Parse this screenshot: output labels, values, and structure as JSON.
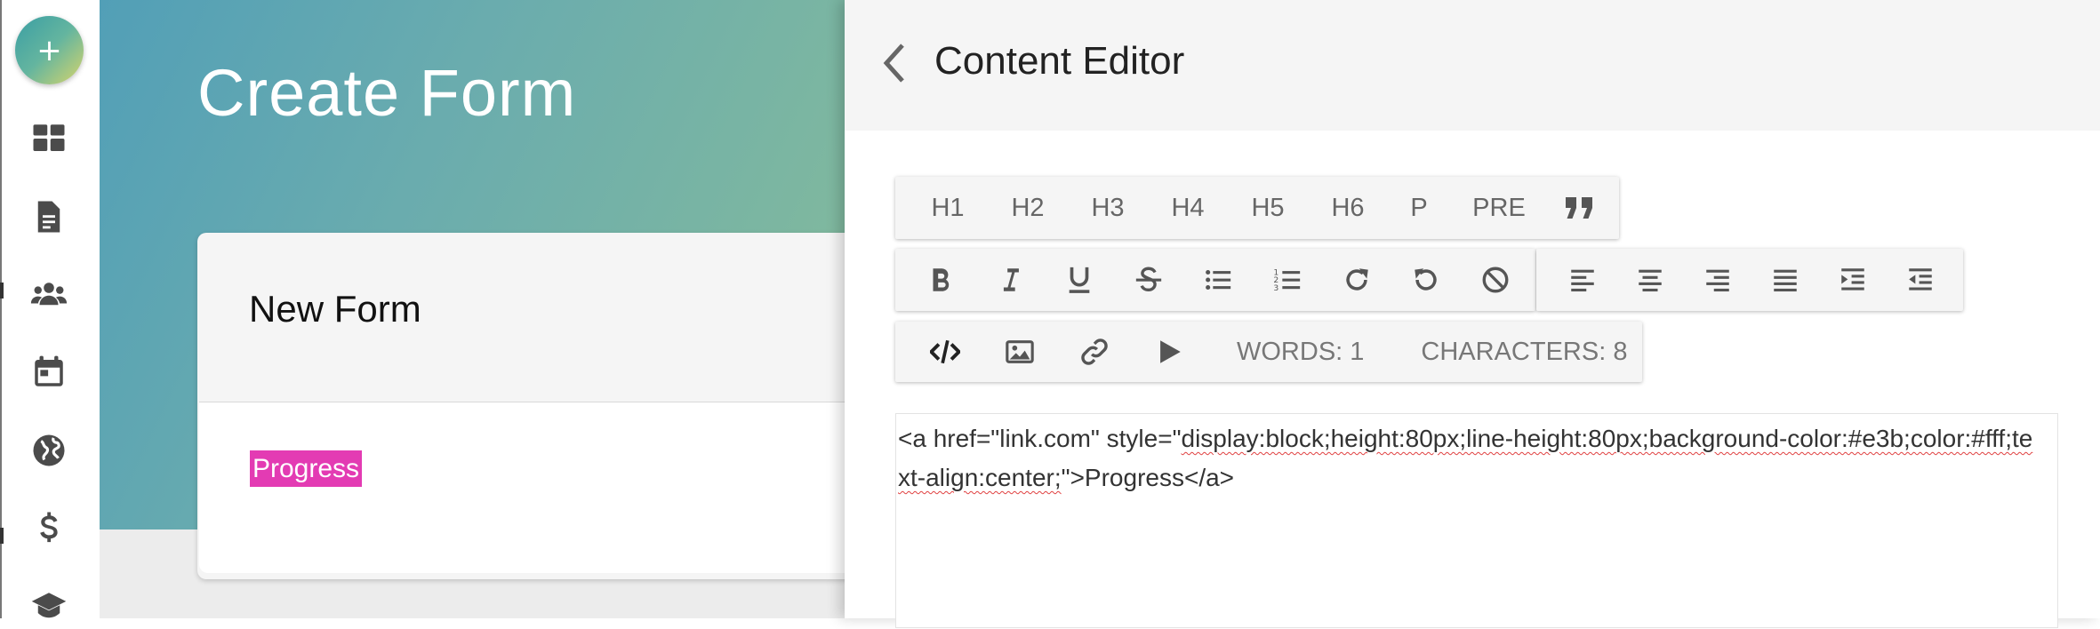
{
  "sidebar": {
    "add_button_icon": "plus-icon",
    "items": [
      {
        "name": "dashboard",
        "icon": "dashboard-grid-icon"
      },
      {
        "name": "documents",
        "icon": "document-icon"
      },
      {
        "name": "users",
        "icon": "users-group-icon"
      },
      {
        "name": "calendar",
        "icon": "calendar-icon"
      },
      {
        "name": "globe",
        "icon": "globe-icon"
      },
      {
        "name": "billing",
        "icon": "dollar-icon"
      },
      {
        "name": "education",
        "icon": "graduation-cap-icon"
      }
    ]
  },
  "page": {
    "title": "Create Form",
    "card_title": "New Form",
    "preview_link_text": "Progress",
    "preview_link_color": "#e33bb3"
  },
  "editor": {
    "panel_title": "Content Editor",
    "back_icon": "chevron-left-icon",
    "heading_buttons": [
      "H1",
      "H2",
      "H3",
      "H4",
      "H5",
      "H6",
      "P",
      "PRE"
    ],
    "quote_icon": "quote-icon",
    "format_icons": [
      "bold-icon",
      "italic-icon",
      "underline-icon",
      "strikethrough-icon",
      "bulleted-list-icon",
      "numbered-list-icon",
      "redo-icon",
      "undo-icon",
      "clear-format-icon"
    ],
    "align_icons": [
      "align-left-icon",
      "align-center-icon",
      "align-right-icon",
      "align-justify-icon",
      "indent-icon",
      "outdent-icon"
    ],
    "insert_icons": [
      "code-view-icon",
      "image-icon",
      "link-icon",
      "video-icon"
    ],
    "words_label": "WORDS: 1",
    "characters_label": "CHARACTERS: 8",
    "source_part1": "<a href=\"link.com\" style=\"",
    "source_part2": "display:block;height:80px;line-height:80px;background-color:#e3b;color:#fff;text-align:center;",
    "source_part3": "\">Progress</a>"
  }
}
